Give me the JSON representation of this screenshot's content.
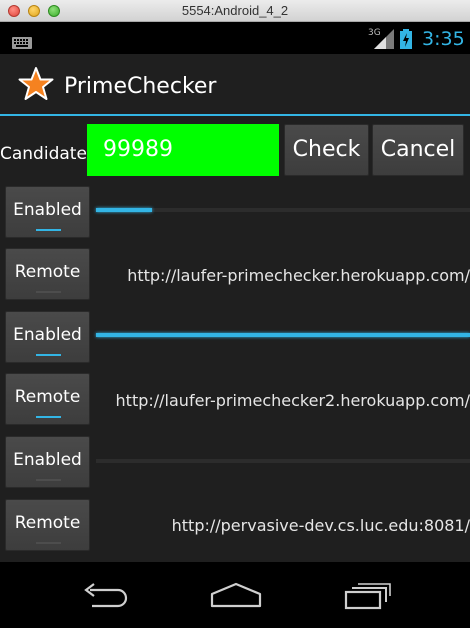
{
  "window": {
    "title": "5554:Android_4_2"
  },
  "status_bar": {
    "network": "3G",
    "time": "3:35",
    "accent_color": "#33b5e5"
  },
  "action_bar": {
    "app_title": "PrimeChecker",
    "icon": "star-icon"
  },
  "form": {
    "candidate_label": "Candidate:",
    "candidate_value": "99989",
    "input_bg_color": "#00ff00",
    "check_label": "Check",
    "cancel_label": "Cancel"
  },
  "rows": [
    {
      "button_label": "Enabled",
      "toggled": true,
      "progress": 0.15
    },
    {
      "button_label": "Remote",
      "toggled": false,
      "url": "http://laufer-primechecker.herokuapp.com/"
    },
    {
      "button_label": "Enabled",
      "toggled": true,
      "progress": 1.0
    },
    {
      "button_label": "Remote",
      "toggled": true,
      "url": "http://laufer-primechecker2.herokuapp.com/"
    },
    {
      "button_label": "Enabled",
      "toggled": false,
      "progress": 0.0
    },
    {
      "button_label": "Remote",
      "toggled": false,
      "url": "http://pervasive-dev.cs.luc.edu:8081/"
    }
  ],
  "nav_bar": {
    "icons": [
      "back-icon",
      "home-icon",
      "recent-apps-icon"
    ]
  }
}
